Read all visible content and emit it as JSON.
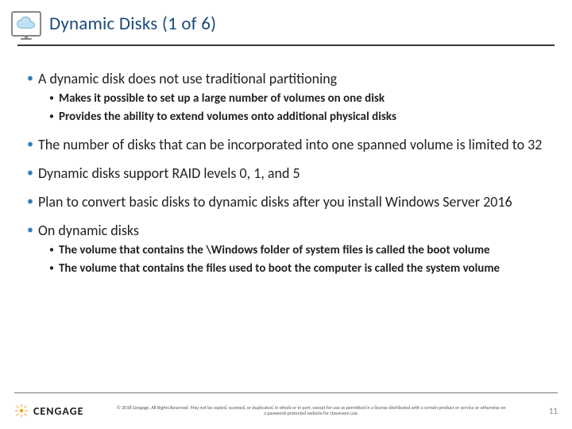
{
  "header": {
    "title": "Dynamic Disks (1 of 6)",
    "icon": "cloud-monitor-icon"
  },
  "bullets": [
    {
      "text": "A dynamic disk does not use traditional partitioning",
      "sub": [
        "Makes it possible to set up a large number of volumes on one disk",
        "Provides the ability to extend volumes onto additional physical disks"
      ]
    },
    {
      "text": "The number of disks that can be incorporated into one spanned volume is limited to 32",
      "sub": []
    },
    {
      "text": "Dynamic disks support RAID levels 0, 1, and 5",
      "sub": []
    },
    {
      "text": "Plan to convert basic disks to dynamic disks after you install Windows Server 2016",
      "sub": []
    },
    {
      "text": "On dynamic disks",
      "sub": [
        "The volume that contains the \\Windows folder of system files is called the boot volume",
        "The volume that contains the files used to boot the computer is called the system volume"
      ]
    }
  ],
  "footer": {
    "brand": "CENGAGE",
    "copyright": "© 2018 Cengage. All Rights Reserved. May not be copied, scanned, or duplicated, in whole or in part, except for use as permitted in a license distributed with a certain product or service or otherwise on a password-protected website for classroom use.",
    "page": "11"
  }
}
